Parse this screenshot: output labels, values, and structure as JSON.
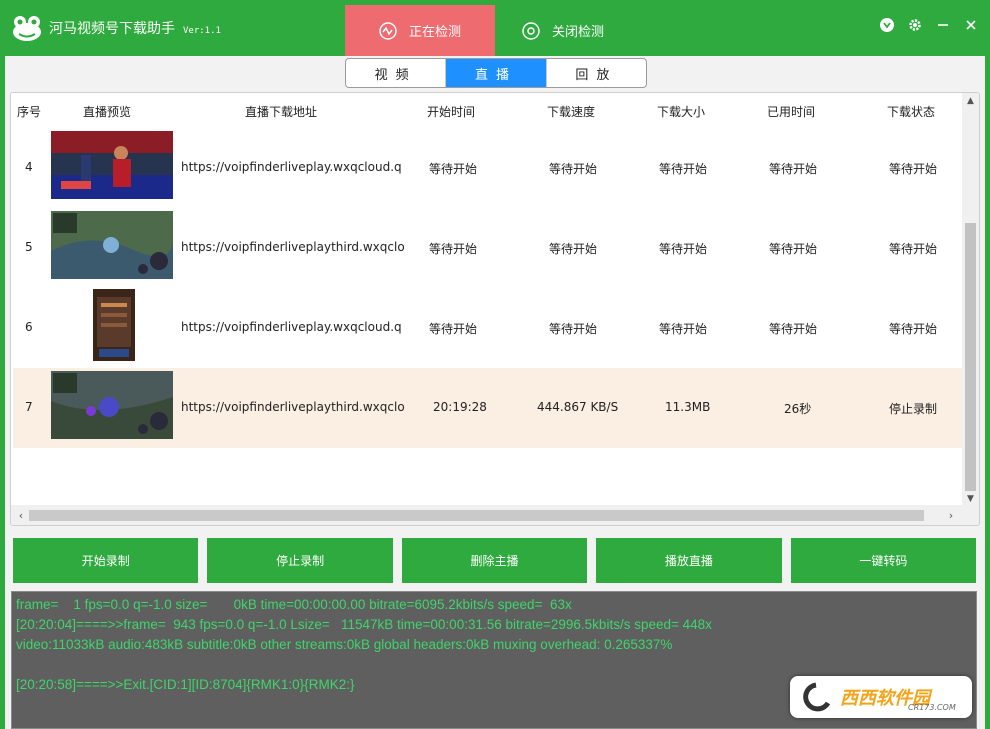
{
  "app": {
    "title": "河马视频号下载助手",
    "version": "Ver:1.1"
  },
  "mode_tabs": [
    {
      "label": "正在检测",
      "active": true
    },
    {
      "label": "关闭检测",
      "active": false
    }
  ],
  "colors": {
    "brand_green": "#2eaa3e",
    "active_tab_red": "#ee6b6f",
    "segment_blue": "#1e90ff",
    "highlight_row": "#fbeee3",
    "console_text": "#3dd66a"
  },
  "segments": [
    {
      "label": "视频",
      "active": false
    },
    {
      "label": "直播",
      "active": true
    },
    {
      "label": "回放",
      "active": false
    }
  ],
  "table": {
    "headers": [
      "序号",
      "直播预览",
      "直播下载地址",
      "开始时间",
      "下载速度",
      "下载大小",
      "已用时间",
      "下载状态"
    ],
    "rows": [
      {
        "num": "4",
        "thumb": "basketball-stream",
        "url": "https://voipfinderliveplay.wxqcloud.q",
        "start": "等待开始",
        "speed": "等待开始",
        "size": "等待开始",
        "elapsed": "等待开始",
        "status": "等待开始",
        "highlight": false
      },
      {
        "num": "5",
        "thumb": "moba-game-stream",
        "url": "https://voipfinderliveplaythird.wxqclo",
        "start": "等待开始",
        "speed": "等待开始",
        "size": "等待开始",
        "elapsed": "等待开始",
        "status": "等待开始",
        "highlight": false
      },
      {
        "num": "6",
        "thumb": "vertical-game-stream",
        "url": "https://voipfinderliveplay.wxqcloud.q",
        "start": "等待开始",
        "speed": "等待开始",
        "size": "等待开始",
        "elapsed": "等待开始",
        "status": "等待开始",
        "highlight": false
      },
      {
        "num": "7",
        "thumb": "moba-game-stream-2",
        "url": "https://voipfinderliveplaythird.wxqclo",
        "start": "20:19:28",
        "speed": "444.867 KB/S",
        "size": "11.3MB",
        "elapsed": "26秒",
        "status": "停止录制",
        "highlight": true
      }
    ]
  },
  "actions": [
    "开始录制",
    "停止录制",
    "删除主播",
    "播放直播",
    "一键转码"
  ],
  "console": [
    "frame=    1 fps=0.0 q=-1.0 size=       0kB time=00:00:00.00 bitrate=6095.2kbits/s speed=  63x",
    "[20:20:04]====>>frame=  943 fps=0.0 q=-1.0 Lsize=   11547kB time=00:00:31.56 bitrate=2996.5kbits/s speed= 448x",
    "video:11033kB audio:483kB subtitle:0kB other streams:0kB global headers:0kB muxing overhead: 0.265337%",
    "",
    "[20:20:58]====>>Exit.[CID:1][ID:8704]{RMK1:0}{RMK2:}"
  ],
  "watermark": {
    "main": "西西软件园",
    "sub": "CR173.COM"
  },
  "icons": {
    "logo": "frog-logo-icon",
    "detect": "wave-circle-icon",
    "close_detect": "stop-circle-icon",
    "menu": "dropdown-circle-icon",
    "settings": "gear-icon",
    "minimize": "minimize-icon",
    "close": "close-icon"
  }
}
